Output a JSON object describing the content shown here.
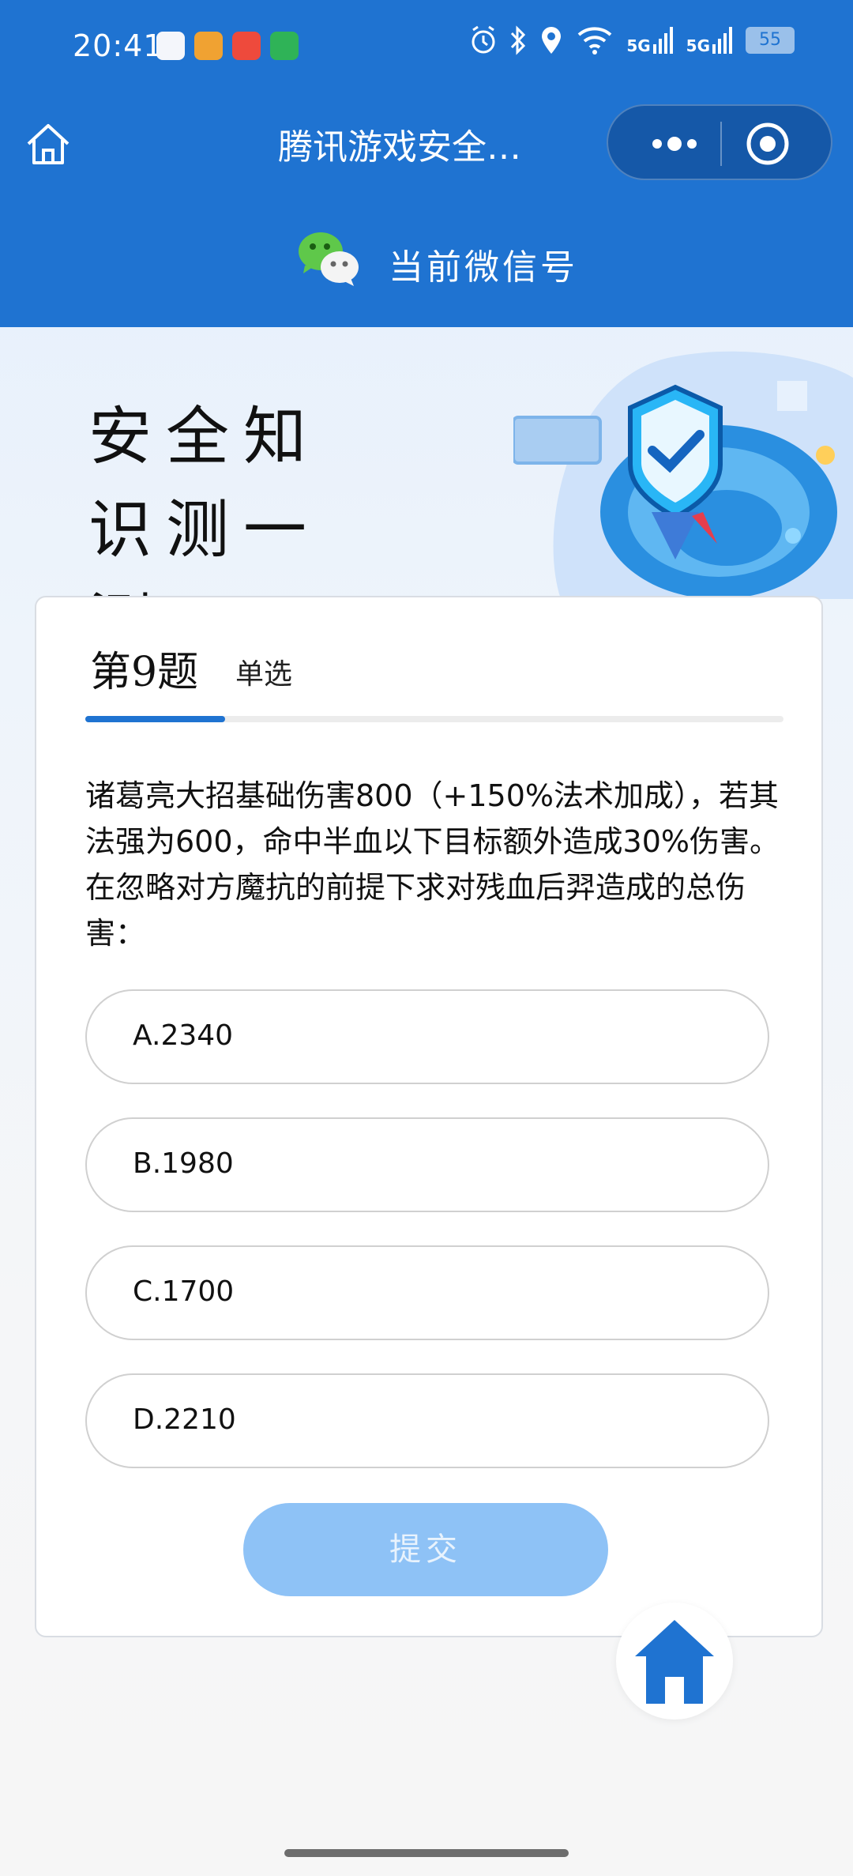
{
  "status_bar": {
    "time": "20:41",
    "signal_1": "5G",
    "signal_2": "5G",
    "battery": "55"
  },
  "navbar": {
    "title": "腾讯游戏安全…"
  },
  "account": {
    "label": "当前微信号"
  },
  "banner": {
    "title": "安全知识测一测"
  },
  "quiz": {
    "number": "第9题",
    "type": "单选",
    "progress": 0.2,
    "question": "诸葛亮大招基础伤害800（+150%法术加成），若其法强为600，命中半血以下目标额外造成30%伤害。在忽略对方魔抗的前提下求对残血后羿造成的总伤害：",
    "options": [
      {
        "label": "A.2340"
      },
      {
        "label": "B.1980"
      },
      {
        "label": "C.1700"
      },
      {
        "label": "D.2210"
      }
    ],
    "submit_label": "提交"
  },
  "colors": {
    "brand_blue": "#1f73d1",
    "submit_disabled": "#8ec2f6"
  },
  "icons": [
    "home-icon",
    "more-icon",
    "close-target-icon",
    "wechat-icon",
    "home-float-icon"
  ]
}
